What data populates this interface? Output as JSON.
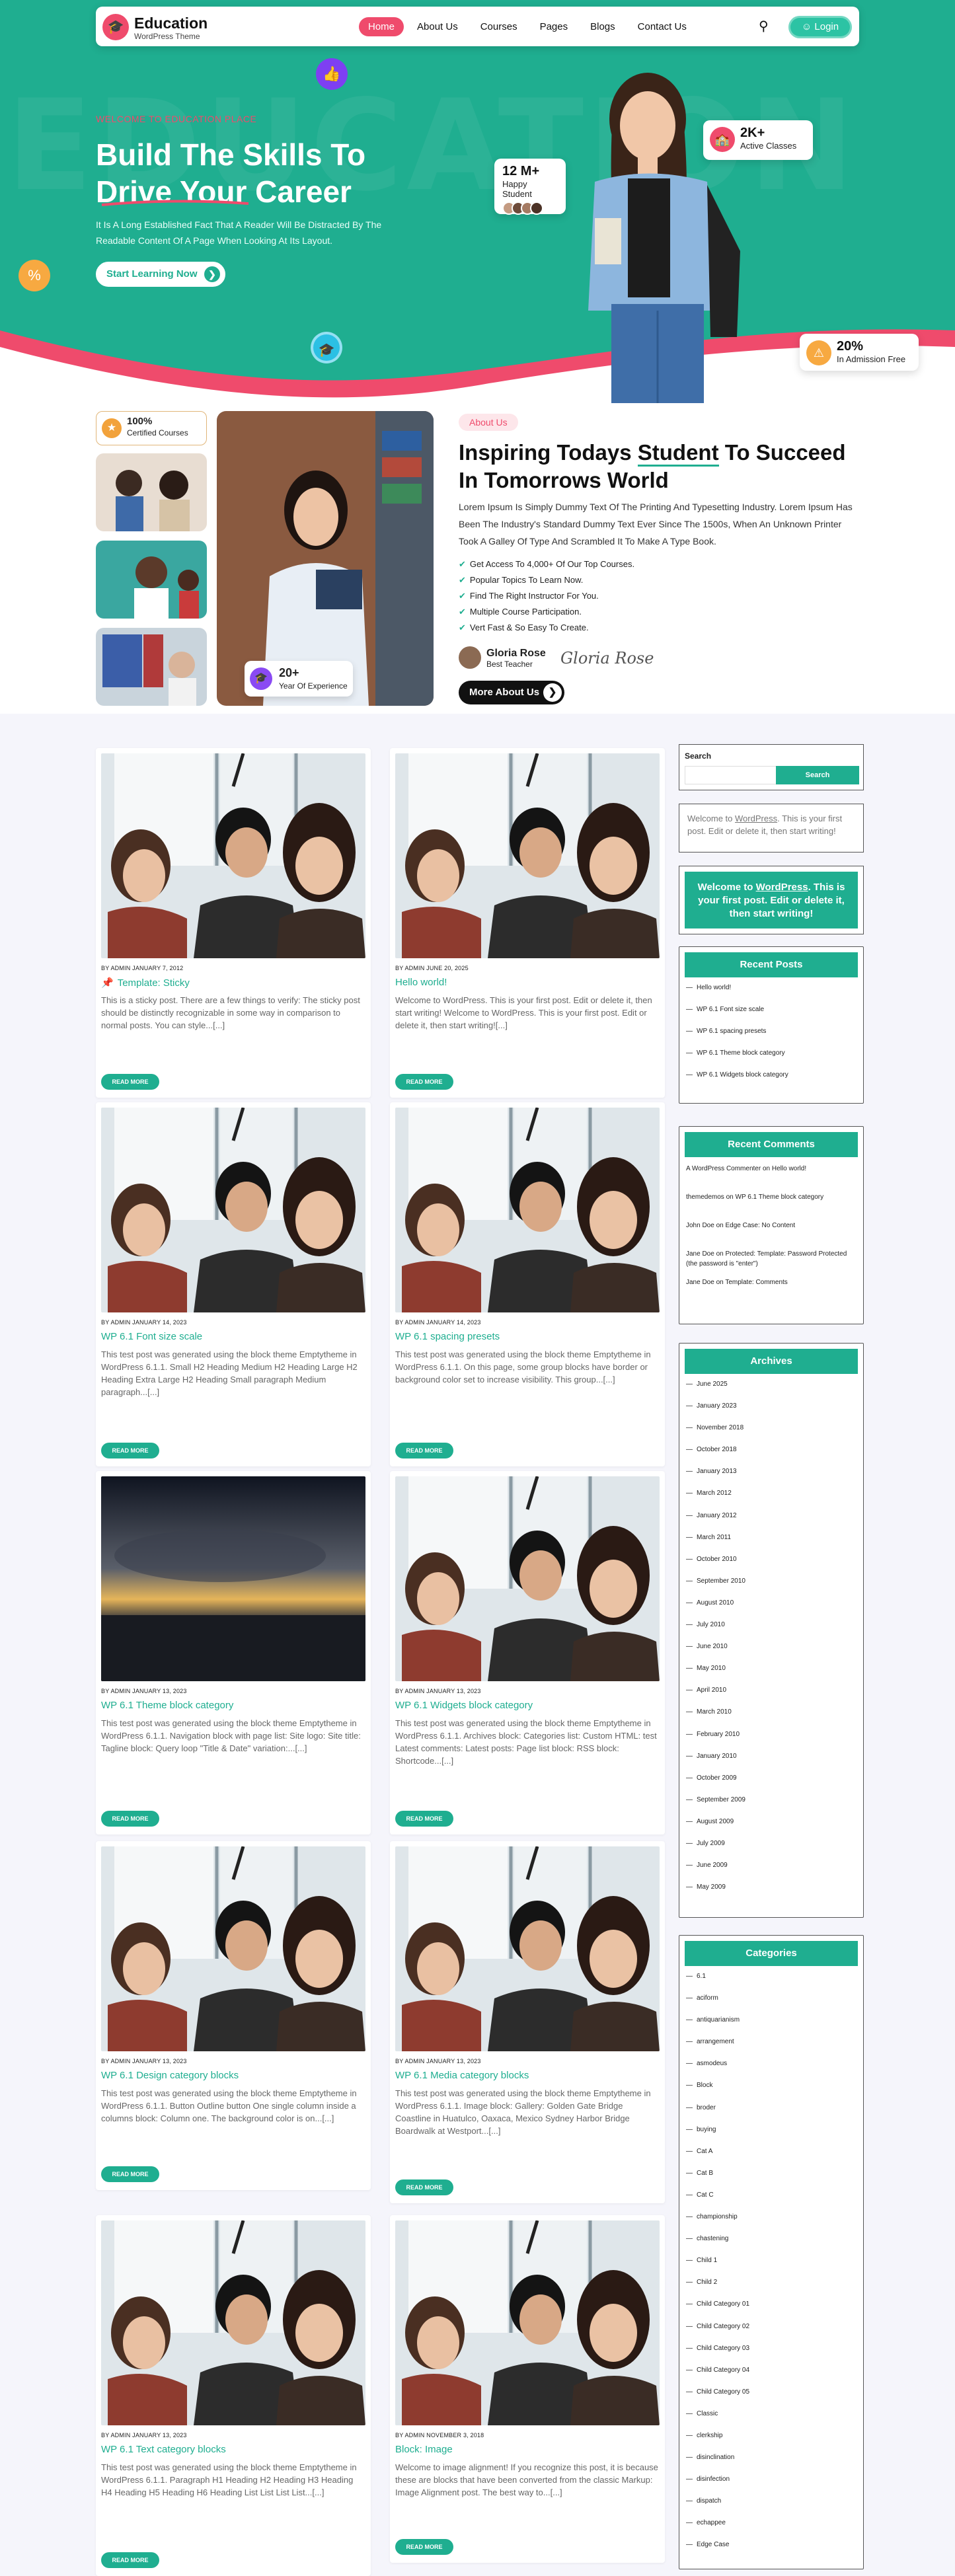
{
  "nav": {
    "logo_title": "Education",
    "logo_sub": "WordPress Theme",
    "menu": [
      "Home",
      "About Us",
      "Courses",
      "Pages",
      "Blogs",
      "Contact Us"
    ],
    "login": "Login"
  },
  "hero": {
    "bg_text": "EDUCATION",
    "kicker": "WELCOME TO EDUCATION PLACE",
    "title_line1": "Build The Skills To",
    "title_line2": "Drive Your Career",
    "desc": "It Is A Long Established Fact That A Reader Will Be Distracted By The Readable Content Of A Page When Looking At Its Layout.",
    "button": "Start Learning Now",
    "stats": [
      {
        "value": "12 M+",
        "label": "Happy Student"
      },
      {
        "value": "2K+",
        "label": "Active Classes"
      },
      {
        "value": "20%",
        "label": "In Admission Free"
      }
    ]
  },
  "about": {
    "cert_value": "100%",
    "cert_label": "Certified Courses",
    "exp_value": "20+",
    "exp_label": "Year Of Experience",
    "tag": "About Us",
    "title_pre": "Inspiring Todays ",
    "title_highlight": "Student",
    "title_post": " To Succeed In Tomorrows World",
    "desc": "Lorem Ipsum Is Simply Dummy Text Of The Printing And Typesetting Industry. Lorem Ipsum Has Been The Industry's Standard Dummy Text Ever Since The 1500s, When An Unknown Printer Took A Galley Of Type And Scrambled It To Make A Type  Book.",
    "points": [
      "Get Access To 4,000+ Of Our Top Courses.",
      "Popular Topics To Learn Now.",
      "Find The Right Instructor For You.",
      "Multiple Course Participation.",
      "Vert Fast & So Easy To Create."
    ],
    "author_name": "Gloria Rose",
    "author_role": "Best Teacher",
    "signature": "Gloria Rose",
    "more_button": "More About Us"
  },
  "posts": [
    {
      "meta": "BY ADMIN    JANUARY 7, 2012",
      "title": "Template: Sticky",
      "sticky": true,
      "excerpt": "This is a sticky post. There are a few things to verify: The sticky post should be distinctly recognizable in some way in comparison to normal posts. You can style...[...]",
      "img": "students"
    },
    {
      "meta": "BY ADMIN    JUNE 20, 2025",
      "title": "Hello world!",
      "excerpt": "Welcome to WordPress. This is your first post. Edit or delete it, then start writing! Welcome to WordPress. This is your first post. Edit or delete it, then start writing![...]",
      "img": "students"
    },
    {
      "meta": "BY ADMIN    JANUARY 14, 2023",
      "title": "WP 6.1 Font size scale",
      "excerpt": "This test post was generated using the block theme Emptytheme in WordPress 6.1.1. Small H2 Heading Medium H2 Heading Large H2 Heading Extra Large H2 Heading Small paragraph Medium paragraph...[...]",
      "img": "students"
    },
    {
      "meta": "BY ADMIN    JANUARY 14, 2023",
      "title": "WP 6.1 spacing presets",
      "excerpt": "This test post was generated using the block theme Emptytheme in WordPress 6.1.1. On this page, some group blocks have border or background color set to increase visibility. This group...[...]",
      "img": "students"
    },
    {
      "meta": "BY ADMIN    JANUARY 13, 2023",
      "title": "WP 6.1 Theme block category",
      "excerpt": "This test post was generated using the block theme Emptytheme in WordPress 6.1.1. Navigation block with page list: Site logo: Site title: Tagline block: Query loop \"Title & Date\" variation:...[...]",
      "img": "sunset"
    },
    {
      "meta": "BY ADMIN    JANUARY 13, 2023",
      "title": "WP 6.1 Widgets block category",
      "excerpt": "This test post was generated using the block theme Emptytheme in WordPress 6.1.1. Archives block: Categories list: Custom HTML: test Latest comments: Latest posts: Page list block: RSS block: Shortcode...[...]",
      "img": "students"
    },
    {
      "meta": "BY ADMIN    JANUARY 13, 2023",
      "title": "WP 6.1 Design category blocks",
      "excerpt": "This test post was generated using the block theme Emptytheme in WordPress 6.1.1. Button Outline button One single column inside a columns block: Column one. The background color is on...[...]",
      "img": "students"
    },
    {
      "meta": "BY ADMIN    JANUARY 13, 2023",
      "title": "WP 6.1 Media category blocks",
      "excerpt": "This test post was generated using the block theme Emptytheme in WordPress 6.1.1. Image block: Gallery: Golden Gate Bridge Coastline in Huatulco, Oaxaca, Mexico Sydney Harbor Bridge Boardwalk at Westport...[...]",
      "img": "students"
    },
    {
      "meta": "BY ADMIN    JANUARY 13, 2023",
      "title": "WP 6.1 Text category blocks",
      "excerpt": "This test post was generated using the block theme Emptytheme in WordPress 6.1.1. Paragraph H1 Heading H2 Heading H3 Heading H4 Heading H5 Heading H6 Heading List List List List...[...]",
      "img": "students"
    },
    {
      "meta": "BY ADMIN    NOVEMBER 3, 2018",
      "title": "Block: Image",
      "excerpt": "Welcome to image alignment! If you recognize this post, it is because these are blocks that have been converted from the classic Markup: Image Alignment post. The best way to...[...]",
      "img": "students"
    }
  ],
  "read_more": "READ MORE",
  "sidebar": {
    "search_label": "Search",
    "search_button": "Search",
    "welcome_pre": "Welcome to ",
    "welcome_link": "WordPress",
    "welcome_post": ". This is your first post. Edit or delete it, then start writing!",
    "recent_posts_title": "Recent Posts",
    "recent_posts": [
      "Hello world!",
      "WP 6.1 Font size scale",
      "WP 6.1 spacing presets",
      "WP 6.1 Theme block category",
      "WP 6.1 Widgets block category"
    ],
    "recent_comments_title": "Recent Comments",
    "recent_comments": [
      {
        "author": "A WordPress Commenter",
        "on": "Hello world!"
      },
      {
        "author": "themedemos",
        "on": "WP 6.1 Theme block category"
      },
      {
        "author": "John Doe",
        "on": "Edge Case: No Content"
      },
      {
        "author": "Jane Doe",
        "on": "Protected: Template: Password Protected (the password is \"enter\")"
      },
      {
        "author": "Jane Doe",
        "on": "Template: Comments"
      }
    ],
    "archives_title": "Archives",
    "archives": [
      "June 2025",
      "January 2023",
      "November 2018",
      "October 2018",
      "January 2013",
      "March 2012",
      "January 2012",
      "March 2011",
      "October 2010",
      "September 2010",
      "August 2010",
      "July 2010",
      "June 2010",
      "May 2010",
      "April 2010",
      "March 2010",
      "February 2010",
      "January 2010",
      "October 2009",
      "September 2009",
      "August 2009",
      "July 2009",
      "June 2009",
      "May 2009"
    ],
    "categories_title": "Categories",
    "categories": [
      "6.1",
      "aciform",
      "antiquarianism",
      "arrangement",
      "asmodeus",
      "Block",
      "broder",
      "buying",
      "Cat A",
      "Cat B",
      "Cat C",
      "championship",
      "chastening",
      "Child 1",
      "Child 2",
      "Child Category 01",
      "Child Category 02",
      "Child Category 03",
      "Child Category 04",
      "Child Category 05",
      "Classic",
      "clerkship",
      "disinclination",
      "disinfection",
      "dispatch",
      "echappee",
      "Edge Case"
    ]
  }
}
